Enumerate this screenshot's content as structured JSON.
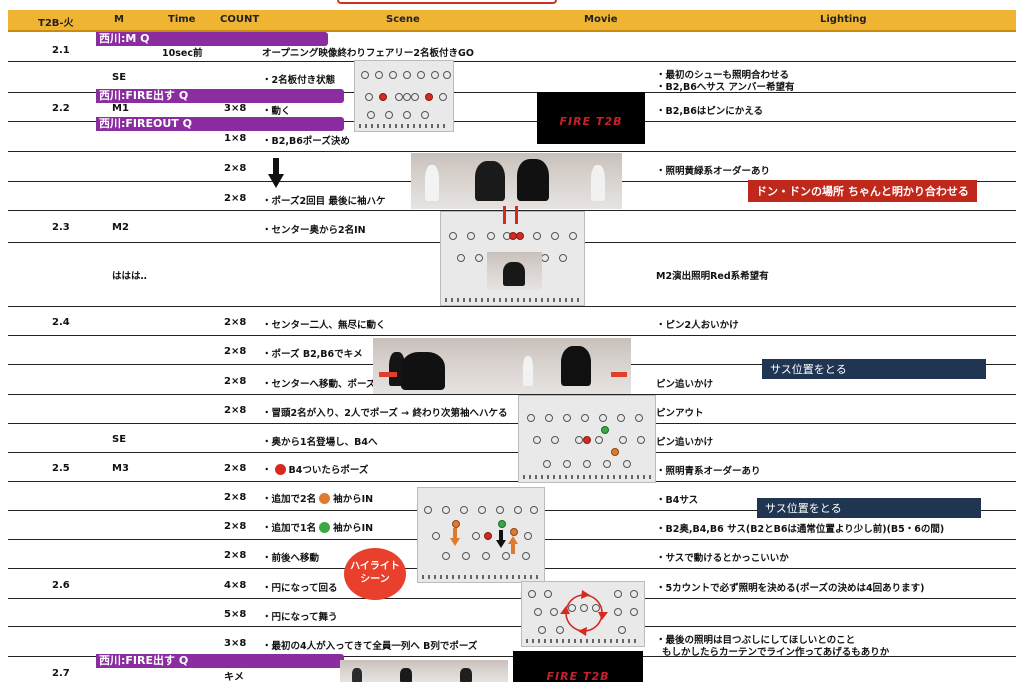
{
  "headers": {
    "t2b": "T2B-火",
    "m": "M",
    "time": "Time",
    "count": "COUNT",
    "scene": "Scene",
    "movie": "Movie",
    "lighting": "Lighting"
  },
  "cues": {
    "cue_mq": "西川:M Q",
    "cue_fire_q": "西川:FIRE出す Q",
    "cue_fireout_q": "西川:FIREOUT Q",
    "cue_fire_q_2": "西川:FIRE出す Q"
  },
  "rows": {
    "r1": {
      "t2b": "2.1",
      "time": "10sec前",
      "scene": "オープニング映像終わりフェアリー2名板付きGO"
    },
    "r2": {
      "m": "SE",
      "scene": "・2名板付き状態",
      "lighting1": "・最初のシューも照明合わせる",
      "lighting2": "・B2,B6へサス アンバー希望有"
    },
    "r3": {
      "t2b": "2.2",
      "m": "M1",
      "count": "3×8",
      "scene": "・動く",
      "lighting": "・B2,B6はピンにかえる"
    },
    "r4": {
      "count": "1×8",
      "scene": "・B2,B6ポーズ決め"
    },
    "r5": {
      "count": "2×8",
      "lighting": "・照明黄緑系オーダーあり"
    },
    "r6": {
      "count": "2×8",
      "scene": "・ポーズ2回目 最後に袖ハケ"
    },
    "r7": {
      "t2b": "2.3",
      "m": "M2",
      "scene": "・センター奥から2名IN"
    },
    "r8": {
      "m": "ははは‥",
      "lighting": "M2演出照明Red系希望有"
    },
    "r9": {
      "t2b": "2.4",
      "count": "2×8",
      "scene": "・センター二人、無尽に動く",
      "lighting": "・ピン2人おいかけ"
    },
    "r10": {
      "count": "2×8",
      "scene": "・ポーズ B2,B6でキメ"
    },
    "r11": {
      "count": "2×8",
      "scene": "・センターへ移動、ポーズ",
      "lighting": "ピン追いかけ"
    },
    "r12": {
      "count": "2×8",
      "scene": "・冒頭2名が入り、2人でポーズ → 終わり次第袖へハケる",
      "lighting": "ピンアウト"
    },
    "r13": {
      "m": "SE",
      "scene": "・奥から1名登場し、B4へ",
      "lighting": "ピン追いかけ"
    },
    "r14": {
      "t2b": "2.5",
      "m": "M3",
      "count": "2×8",
      "scene_pre": "・",
      "scene": "B4ついたらポーズ",
      "lighting": "・照明青系オーダーあり"
    },
    "r15": {
      "count": "2×8",
      "scene_pre": "・追加で2名",
      "scene": "袖からIN",
      "lighting": "・B4サス"
    },
    "r16": {
      "count": "2×8",
      "scene_pre": "・追加で1名",
      "scene": "袖からIN",
      "lighting": "・B2奥,B4,B6 サス(B2とB6は通常位置より少し前)(B5・6の間)"
    },
    "r17": {
      "count": "2×8",
      "scene": "・前後へ移動",
      "lighting": "・サスで動けるとかっこいいか"
    },
    "r18": {
      "t2b": "2.6",
      "count": "4×8",
      "scene": "・円になって回る",
      "lighting": "・5カウントで必ず照明を決める(ポーズの決めは4回あります)"
    },
    "r19": {
      "count": "5×8",
      "scene": "・円になって舞う"
    },
    "r20": {
      "count": "3×8",
      "scene": "・最初の4人が入ってきて全員一列へ B列でポーズ",
      "lighting1": "・最後の照明は目つぶしにしてほしいとのこと",
      "lighting2": "もしかしたらカーテンでライン作ってあげるもありか"
    },
    "r21": {
      "t2b": "2.7",
      "count": "キメ"
    }
  },
  "banners": {
    "don_don": "ドン・ドンの場所 ちゃんと明かり合わせる",
    "sus1": "サス位置をとる",
    "sus2": "サス位置をとる",
    "highlight": "ハイライト シーン"
  },
  "movie": {
    "logo1": "FIRE T2B",
    "logo2": "FIRE T2B"
  },
  "colors": {
    "header": "#f0b433",
    "cue": "#8b2ca0",
    "alert_red": "#c0281b",
    "navy": "#1f3552",
    "dot_red": "#d42a20",
    "dot_green": "#3aa845",
    "dot_orange": "#e07a2e"
  }
}
